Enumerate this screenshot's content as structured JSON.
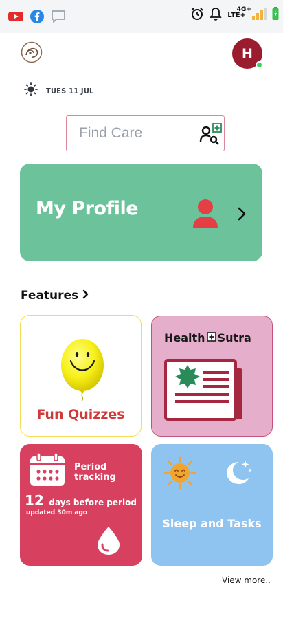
{
  "status_bar": {
    "apps": [
      "youtube-icon",
      "facebook-icon",
      "message-icon"
    ],
    "network": "LTE+",
    "network_gen": "4G+",
    "alarm": true
  },
  "header": {
    "avatar_initial": "H",
    "online": true
  },
  "date": {
    "weather_icon": "sun-icon",
    "label": "TUES 11 JUL"
  },
  "search": {
    "placeholder": "Find Care",
    "icon": "find-care-icon"
  },
  "profile_card": {
    "title": "My Profile",
    "color": "#6cc39b"
  },
  "features": {
    "title": "Features",
    "tiles": {
      "quizzes": {
        "label": "Fun Quizzes",
        "icon": "smiley-balloon-icon"
      },
      "health_sutra": {
        "title_left": "Health",
        "title_right": "Sutra",
        "icon": "newspaper-icon"
      },
      "period": {
        "label": "Period tracking",
        "days_count": "12",
        "days_text": "days before period",
        "updated": "updated 30m ago",
        "icon": "calendar-icon"
      },
      "sleep": {
        "label": "Sleep and Tasks",
        "icons": [
          "sun-face-icon",
          "moon-icon"
        ]
      }
    },
    "view_more": "View more.."
  },
  "colors": {
    "avatar": "#9b1c2e",
    "quiz_border": "#f0de57",
    "health_bg": "#e5aecb",
    "period_bg": "#d8405f",
    "sleep_bg": "#8ec4ef"
  }
}
